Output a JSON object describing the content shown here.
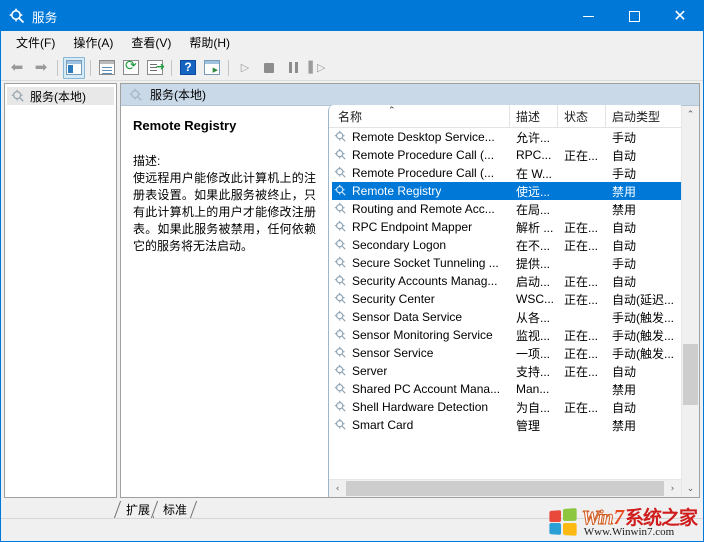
{
  "window": {
    "title": "服务",
    "icon": "services-gear-icon",
    "controls": {
      "minimize": "minimize-button",
      "maximize": "maximize-button",
      "close": "close-button"
    },
    "accent_color": "#0078d7"
  },
  "menubar": {
    "items": [
      {
        "label": "文件(F)",
        "name": "menu-file"
      },
      {
        "label": "操作(A)",
        "name": "menu-action"
      },
      {
        "label": "查看(V)",
        "name": "menu-view"
      },
      {
        "label": "帮助(H)",
        "name": "menu-help"
      }
    ]
  },
  "toolbar": {
    "items": [
      {
        "name": "back-icon",
        "glyph": "⬅"
      },
      {
        "name": "forward-icon",
        "glyph": "➡"
      },
      {
        "name": "show-hide-tree-icon"
      },
      {
        "name": "properties-icon"
      },
      {
        "name": "refresh-icon"
      },
      {
        "name": "export-list-icon"
      },
      {
        "name": "help-icon"
      },
      {
        "name": "show-console-tree-icon"
      },
      {
        "name": "start-service-icon",
        "glyph": "▷"
      },
      {
        "name": "stop-service-icon"
      },
      {
        "name": "pause-service-icon"
      },
      {
        "name": "restart-service-icon",
        "glyph": "▌▷"
      }
    ]
  },
  "tree": {
    "node_label": "服务(本地)"
  },
  "content": {
    "header": "服务(本地)"
  },
  "details": {
    "service_name": "Remote Registry",
    "description_label": "描述:",
    "description_text": "使远程用户能修改此计算机上的注册表设置。如果此服务被终止，只有此计算机上的用户才能修改注册表。如果此服务被禁用，任何依赖它的服务将无法启动。"
  },
  "list": {
    "columns": [
      {
        "label": "名称",
        "name": "column-name",
        "sorted": "asc"
      },
      {
        "label": "描述",
        "name": "column-description"
      },
      {
        "label": "状态",
        "name": "column-status"
      },
      {
        "label": "启动类型",
        "name": "column-startup-type"
      }
    ],
    "sort_caret": "⌃",
    "rows": [
      {
        "name": "Remote Desktop Service...",
        "desc": "允许...",
        "state": "",
        "startup": "手动"
      },
      {
        "name": "Remote Procedure Call (...",
        "desc": "RPC...",
        "state": "正在...",
        "startup": "自动"
      },
      {
        "name": "Remote Procedure Call (...",
        "desc": "在 W...",
        "state": "",
        "startup": "手动"
      },
      {
        "name": "Remote Registry",
        "desc": "使远...",
        "state": "",
        "startup": "禁用",
        "selected": true
      },
      {
        "name": "Routing and Remote Acc...",
        "desc": "在局...",
        "state": "",
        "startup": "禁用"
      },
      {
        "name": "RPC Endpoint Mapper",
        "desc": "解析 ...",
        "state": "正在...",
        "startup": "自动"
      },
      {
        "name": "Secondary Logon",
        "desc": "在不...",
        "state": "正在...",
        "startup": "自动"
      },
      {
        "name": "Secure Socket Tunneling ...",
        "desc": "提供...",
        "state": "",
        "startup": "手动"
      },
      {
        "name": "Security Accounts Manag...",
        "desc": "启动...",
        "state": "正在...",
        "startup": "自动"
      },
      {
        "name": "Security Center",
        "desc": "WSC...",
        "state": "正在...",
        "startup": "自动(延迟..."
      },
      {
        "name": "Sensor Data Service",
        "desc": "从各...",
        "state": "",
        "startup": "手动(触发..."
      },
      {
        "name": "Sensor Monitoring Service",
        "desc": "监视...",
        "state": "正在...",
        "startup": "手动(触发..."
      },
      {
        "name": "Sensor Service",
        "desc": "一项...",
        "state": "正在...",
        "startup": "手动(触发..."
      },
      {
        "name": "Server",
        "desc": "支持...",
        "state": "正在...",
        "startup": "自动"
      },
      {
        "name": "Shared PC Account Mana...",
        "desc": "Man...",
        "state": "",
        "startup": "禁用"
      },
      {
        "name": "Shell Hardware Detection",
        "desc": "为自...",
        "state": "正在...",
        "startup": "自动"
      },
      {
        "name": "Smart Card",
        "desc": "管理",
        "state": "",
        "startup": "禁用"
      }
    ],
    "scroll": {
      "up_arrow": "⌃",
      "down_arrow": "⌄",
      "left_arrow": "‹",
      "right_arrow": "›"
    }
  },
  "tabs": [
    {
      "label": "扩展",
      "name": "tab-extended"
    },
    {
      "label": "标准",
      "name": "tab-standard"
    }
  ],
  "watermark": {
    "win": "Win",
    "seven": "7",
    "cn": "系统之家",
    "url": "Www.Winwin7.com"
  }
}
